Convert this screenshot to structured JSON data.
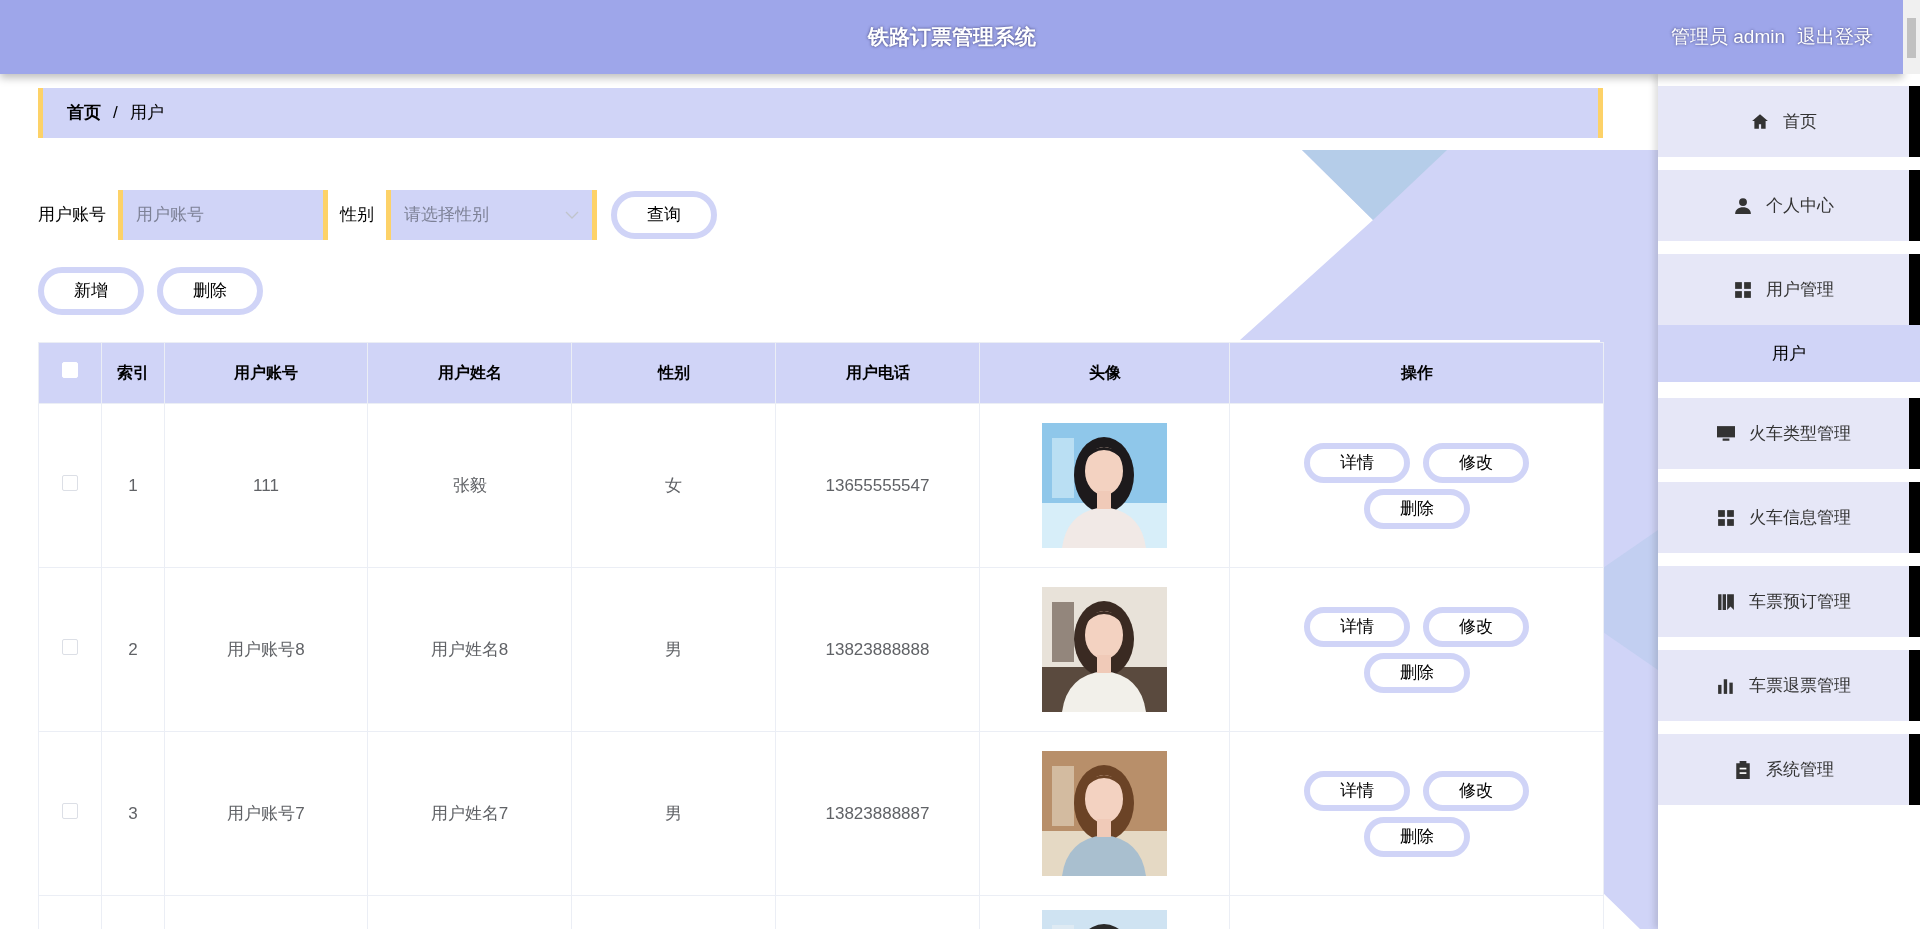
{
  "header": {
    "title": "铁路订票管理系统",
    "user": "管理员 admin",
    "logout": "退出登录"
  },
  "breadcrumb": [
    "首页",
    "/",
    "用户"
  ],
  "search": {
    "fields": [
      {
        "label": "用户账号",
        "placeholder": "用户账号",
        "kind": "input"
      },
      {
        "label": "性别",
        "placeholder": "请选择性别",
        "kind": "select"
      }
    ],
    "button": "查询"
  },
  "actions": [
    "新增",
    "删除"
  ],
  "table": {
    "columns": [
      "索引",
      "用户账号",
      "用户姓名",
      "性别",
      "用户电话",
      "头像",
      "操作"
    ],
    "header_checked": false,
    "rows": [
      {
        "checked": false,
        "index": "1",
        "account": "111",
        "name": "张毅",
        "gender": "女",
        "phone": "13655555547",
        "avatar": {
          "kind": "picture"
        },
        "buttons": [
          "详情",
          "修改",
          "删除"
        ]
      },
      {
        "checked": false,
        "index": "2",
        "account": "用户账号8",
        "name": "用户姓名8",
        "gender": "男",
        "phone": "13823888888",
        "avatar": {
          "kind": "picture"
        },
        "buttons": [
          "详情",
          "修改",
          "删除"
        ]
      },
      {
        "checked": false,
        "index": "3",
        "account": "用户账号7",
        "name": "用户姓名7",
        "gender": "男",
        "phone": "13823888887",
        "avatar": {
          "kind": "picture"
        },
        "buttons": [
          "详情",
          "修改",
          "删除"
        ]
      },
      {
        "avatar": {
          "kind": "picture"
        }
      }
    ]
  },
  "sidebar": {
    "items": [
      {
        "label": "首页",
        "selected": false
      },
      {
        "label": "个人中心",
        "selected": false
      },
      {
        "label": "用户管理",
        "selected": false,
        "children": [
          {
            "label": "用户",
            "selected": true
          }
        ]
      },
      {
        "label": "火车类型管理",
        "selected": false
      },
      {
        "label": "火车信息管理",
        "selected": false
      },
      {
        "label": "车票预订管理",
        "selected": false
      },
      {
        "label": "车票退票管理",
        "selected": false
      },
      {
        "label": "系统管理",
        "selected": false
      }
    ]
  }
}
